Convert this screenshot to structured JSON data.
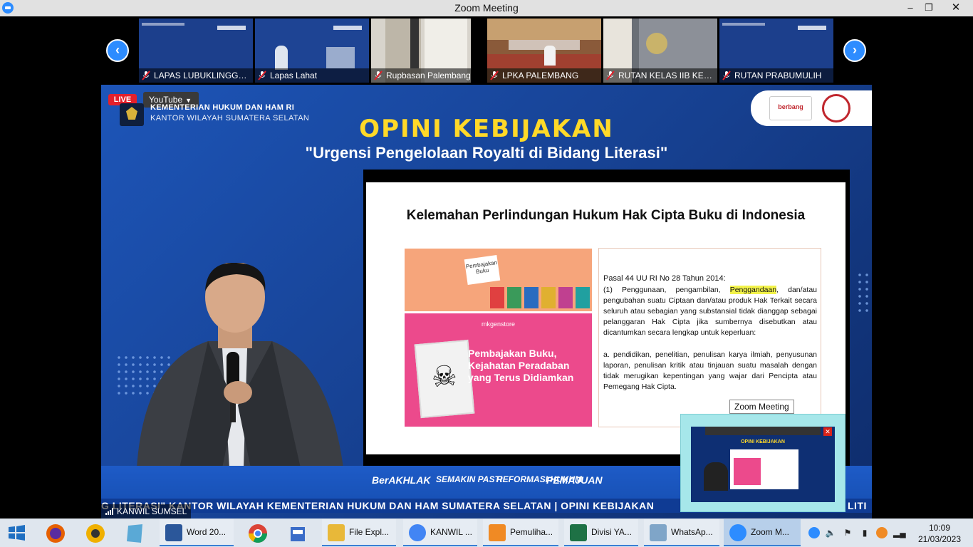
{
  "window": {
    "title": "Zoom Meeting",
    "min_glyph": "–",
    "max_glyph": "❐",
    "close_glyph": "✕"
  },
  "gallery": {
    "prev_glyph": "‹",
    "next_glyph": "›",
    "tiles": [
      {
        "name": "LAPAS LUBUKLINGGA...",
        "bg": "#1c3f8c"
      },
      {
        "name": "Lapas Lahat",
        "bg": "#1e4494"
      },
      {
        "name": "Rupbasan Palembang",
        "bg": "#c9c4b8"
      },
      {
        "name": "LPKA PALEMBANG",
        "bg": "#8a5a3a"
      },
      {
        "name": "RUTAN KELAS IIB KEB...",
        "bg": "#5a5f66"
      },
      {
        "name": "RUTAN PRABUMULIH",
        "bg": "#1c3f8c"
      }
    ]
  },
  "stream": {
    "live": "LIVE",
    "source": "YouTube",
    "org_line1": "KEMENTERIAN HUKUM DAN HAM RI",
    "org_line2": "KANTOR WILAYAH SUMATERA SELATAN",
    "partner_text": "berbang",
    "title": "OPINI KEBIJAKAN",
    "subtitle": "\"Urgensi Pengelolaan Royalti di Bidang Literasi\"",
    "slide": {
      "heading": "Kelemahan Perlindungan Hukum Hak Cipta Buku di Indonesia",
      "hands_label": "Pembajakan Buku",
      "brand": "mkgenstore",
      "piracy_text": "Pembajakan Buku, Kejahatan Peradaban yang Terus Didiamkan",
      "law_title": "Pasal 44 UU RI No 28 Tahun 2014:",
      "law_p1_a": "(1) Penggunaan, pengambilan, ",
      "law_p1_hl": "Penggandaan",
      "law_p1_b": ", dan/atau pengubahan suatu Ciptaan dan/atau produk Hak Terkait secara seluruh atau sebagian yang substansial tidak dianggap sebagai pelanggaran Hak Cipta jika sumbernya disebutkan atau dicantumkan secara lengkap untuk keperluan:",
      "law_pa": "a. pendidikan, penelitian, penulisan karya ilmiah, penyusunan laporan, penulisan kritik atau tinjauan suatu masalah dengan tidak merugikan kepentingan yang wajar dari Pencipta atau Pemegang Hak Cipta."
    },
    "bottom_logos": [
      "BerAKHLAK",
      "SEMAKIN PASTI",
      "REFORMASI HUKUM",
      "PEMAJUAN"
    ],
    "ticker": "G LITERASI\" KANTOR WILAYAH KEMENTERIAN HUKUM DAN HAM SUMATERA SELATAN | OPINI KEBIJAKAN",
    "ticker_tail": "LITI",
    "speaker_name": "KANWIL SUMSEL"
  },
  "pip": {
    "tooltip": "Zoom Meeting",
    "title": "OPINI KEBIJAKAN",
    "close_glyph": "✕"
  },
  "taskbar": {
    "apps": [
      {
        "label": "Word 20...",
        "color": "#2b579a"
      },
      {
        "label": "File Expl...",
        "color": "#e8b839"
      },
      {
        "label": "KANWIL ...",
        "color": "#4285f4"
      },
      {
        "label": "Pemuliha...",
        "color": "#f08a24"
      },
      {
        "label": "Divisi YA...",
        "color": "#1e7145"
      },
      {
        "label": "WhatsAp...",
        "color": "#7fa5c8"
      },
      {
        "label": "Zoom M...",
        "color": "#2d8cff"
      }
    ],
    "time": "10:09",
    "date": "21/03/2023"
  },
  "colors": {
    "zoom_blue": "#2d8cff",
    "stream_blue": "#1a4fa8",
    "title_yellow": "#ffd928",
    "live_red": "#e4202a"
  }
}
